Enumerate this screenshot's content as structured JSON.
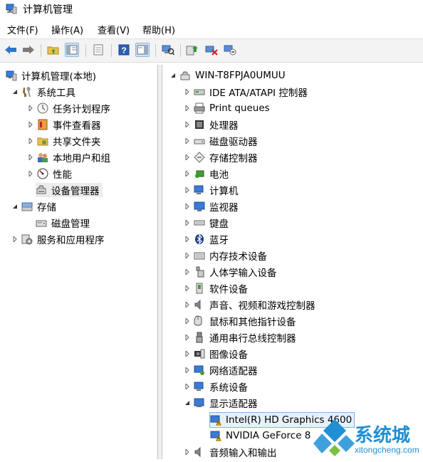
{
  "window": {
    "title": "计算机管理"
  },
  "menu": [
    "文件(F)",
    "操作(A)",
    "查看(V)",
    "帮助(H)"
  ],
  "toolbar": {
    "buttons": [
      "back-icon",
      "forward-icon",
      "up-folder-icon",
      "show-hide-tree-icon",
      "properties-icon",
      "help-icon",
      "action-pane-icon",
      "scan-hardware-icon",
      "update-driver-icon",
      "uninstall-device-icon",
      "disable-device-icon"
    ]
  },
  "left_tree": {
    "root": "计算机管理(本地)",
    "system_tools": "系统工具",
    "task_scheduler": "任务计划程序",
    "event_viewer": "事件查看器",
    "shared_folders": "共享文件夹",
    "local_users": "本地用户和组",
    "performance": "性能",
    "device_manager": "设备管理器",
    "storage": "存储",
    "disk_management": "磁盘管理",
    "services_apps": "服务和应用程序"
  },
  "right_tree": {
    "computer": "WIN-T8FPJA0UMUU",
    "categories": [
      "IDE ATA/ATAPI 控制器",
      "Print queues",
      "处理器",
      "磁盘驱动器",
      "存储控制器",
      "电池",
      "计算机",
      "监视器",
      "键盘",
      "蓝牙",
      "内存技术设备",
      "人体学输入设备",
      "软件设备",
      "声音、视频和游戏控制器",
      "鼠标和其他指针设备",
      "通用串行总线控制器",
      "图像设备",
      "网络适配器",
      "系统设备",
      "显示适配器"
    ],
    "display_children": [
      "Intel(R) HD Graphics 4600",
      "NVIDIA GeForce 8"
    ],
    "last_category": "音频输入和输出"
  },
  "watermark": {
    "brand": "系统城",
    "url": "xitongcheng.com"
  },
  "colors": {
    "warning": "#f2c200",
    "accent_blue": "#2b78c8",
    "watermark_blue": "#1f8fd6"
  }
}
